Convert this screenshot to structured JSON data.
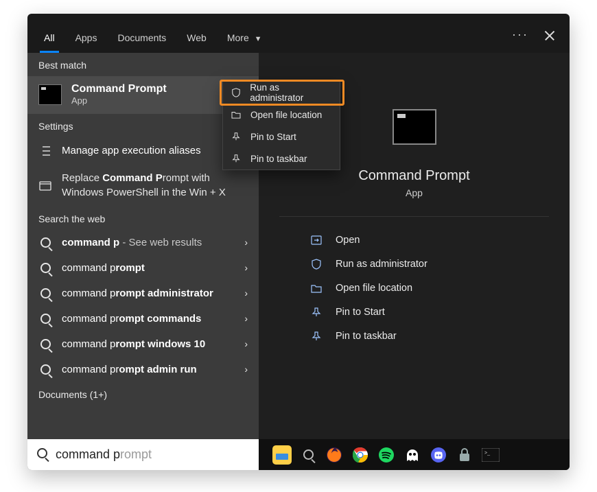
{
  "tabs": {
    "items": [
      "All",
      "Apps",
      "Documents",
      "Web",
      "More"
    ],
    "active_index": 0
  },
  "left": {
    "best_match_label": "Best match",
    "best": {
      "title": "Command Prompt",
      "subtitle": "App"
    },
    "settings_label": "Settings",
    "settings": [
      {
        "text_pre": "Manage app execution aliases",
        "bold": "",
        "text_post": ""
      },
      {
        "text_pre": "Replace ",
        "bold": "Command P",
        "text_post": "rompt with Windows PowerShell in the Win + X"
      }
    ],
    "web_label": "Search the web",
    "web": [
      {
        "pre": "",
        "bold": "command p",
        "post": "",
        "tail": " - See web results"
      },
      {
        "pre": "command p",
        "bold": "rompt",
        "post": "",
        "tail": ""
      },
      {
        "pre": "command p",
        "bold": "rompt administrator",
        "post": "",
        "tail": ""
      },
      {
        "pre": "command pr",
        "bold": "ompt commands",
        "post": "",
        "tail": ""
      },
      {
        "pre": "command p",
        "bold": "rompt windows 10",
        "post": "",
        "tail": ""
      },
      {
        "pre": "command pr",
        "bold": "ompt admin run",
        "post": "",
        "tail": ""
      }
    ],
    "documents_label": "Documents (1+)"
  },
  "context_menu": {
    "items": [
      {
        "icon": "shield",
        "label": "Run as administrator"
      },
      {
        "icon": "folder",
        "label": "Open file location"
      },
      {
        "icon": "pin",
        "label": "Pin to Start"
      },
      {
        "icon": "pin",
        "label": "Pin to taskbar"
      }
    ]
  },
  "right": {
    "title": "Command Prompt",
    "subtitle": "App",
    "actions": [
      {
        "icon": "open",
        "label": "Open"
      },
      {
        "icon": "shield",
        "label": "Run as administrator"
      },
      {
        "icon": "folder",
        "label": "Open file location"
      },
      {
        "icon": "pin",
        "label": "Pin to Start"
      },
      {
        "icon": "pin",
        "label": "Pin to taskbar"
      }
    ]
  },
  "search": {
    "typed": "command p",
    "ghost": "rompt"
  },
  "taskbar_icons": [
    "explorer",
    "search",
    "firefox",
    "chrome",
    "spotify",
    "ghost",
    "discord",
    "lock",
    "terminal"
  ],
  "colors": {
    "accent": "#0a84ff",
    "highlight": "#f08a24"
  }
}
